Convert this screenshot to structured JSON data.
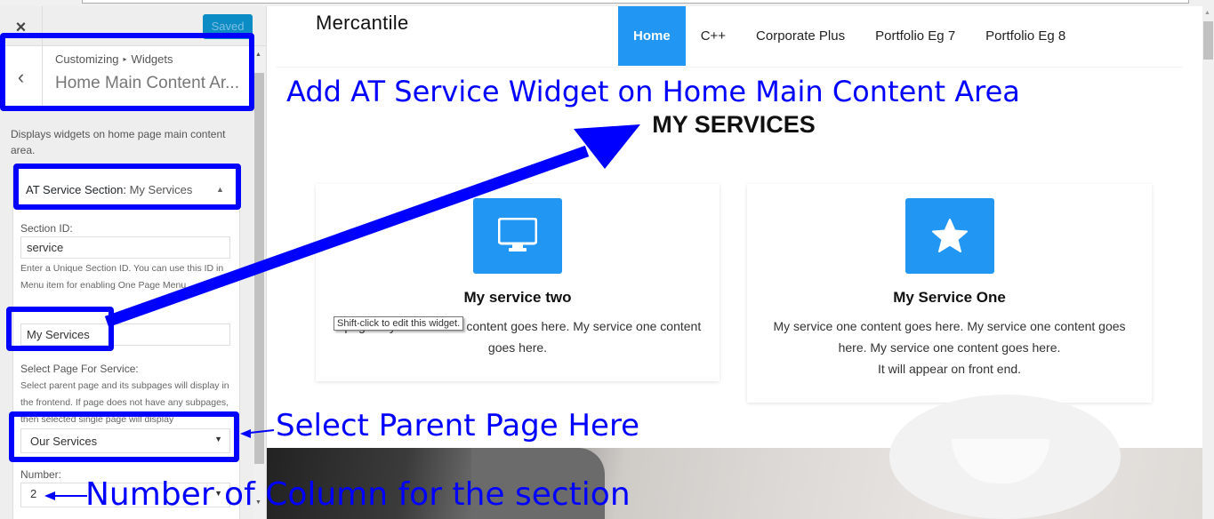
{
  "customizer": {
    "close_label": "×",
    "saved_label": "Saved",
    "back_label": "‹",
    "breadcrumb": {
      "root": "Customizing",
      "separator": "▸",
      "current": "Widgets"
    },
    "section_title": "Home Main Content Ar...",
    "description": "Displays widgets on home page main content area.",
    "widget": {
      "title_prefix": "AT Service Section:",
      "title_name": "My Services",
      "toggle_icon": "▲",
      "fields": {
        "section_id": {
          "label": "Section ID:",
          "value": "service",
          "help": "Enter a Unique Section ID. You can use this ID in Menu item for enabling One Page Menu"
        },
        "title": {
          "value": "My Services"
        },
        "select_page": {
          "label": "Select Page For Service:",
          "help": "Select parent page and its subpages will display in the frontend. If page does not have any subpages, then selected single page will display",
          "selected": "Our Services",
          "caret": "▼"
        },
        "number": {
          "label": "Number:",
          "selected": "2",
          "caret": "▼"
        }
      }
    }
  },
  "preview": {
    "site_title": "Mercantile",
    "nav": [
      {
        "label": "Home",
        "active": true
      },
      {
        "label": "C++",
        "active": false
      },
      {
        "label": "Corporate Plus",
        "active": false
      },
      {
        "label": "Portfolio Eg 7",
        "active": false
      },
      {
        "label": "Portfolio Eg 8",
        "active": false
      }
    ],
    "section_heading": "MY SERVICES",
    "cards": [
      {
        "icon": "desktop-icon",
        "title": "My service two",
        "text": "...page. My service one content goes here. My service one content goes here."
      },
      {
        "icon": "star-icon",
        "title": "My Service One",
        "text": "My service one content goes here. My service one content goes here. My service one content goes here.",
        "text2": "It will appear on front end."
      }
    ],
    "tooltip": "Shift-click to edit this widget.",
    "accent_color": "#2196f3"
  },
  "annotations": {
    "color": "#0000ff",
    "heading": "Add AT Service Widget on Home Main Content Area",
    "select_parent": "Select Parent Page Here",
    "number_column": "Number of Column for the section"
  }
}
